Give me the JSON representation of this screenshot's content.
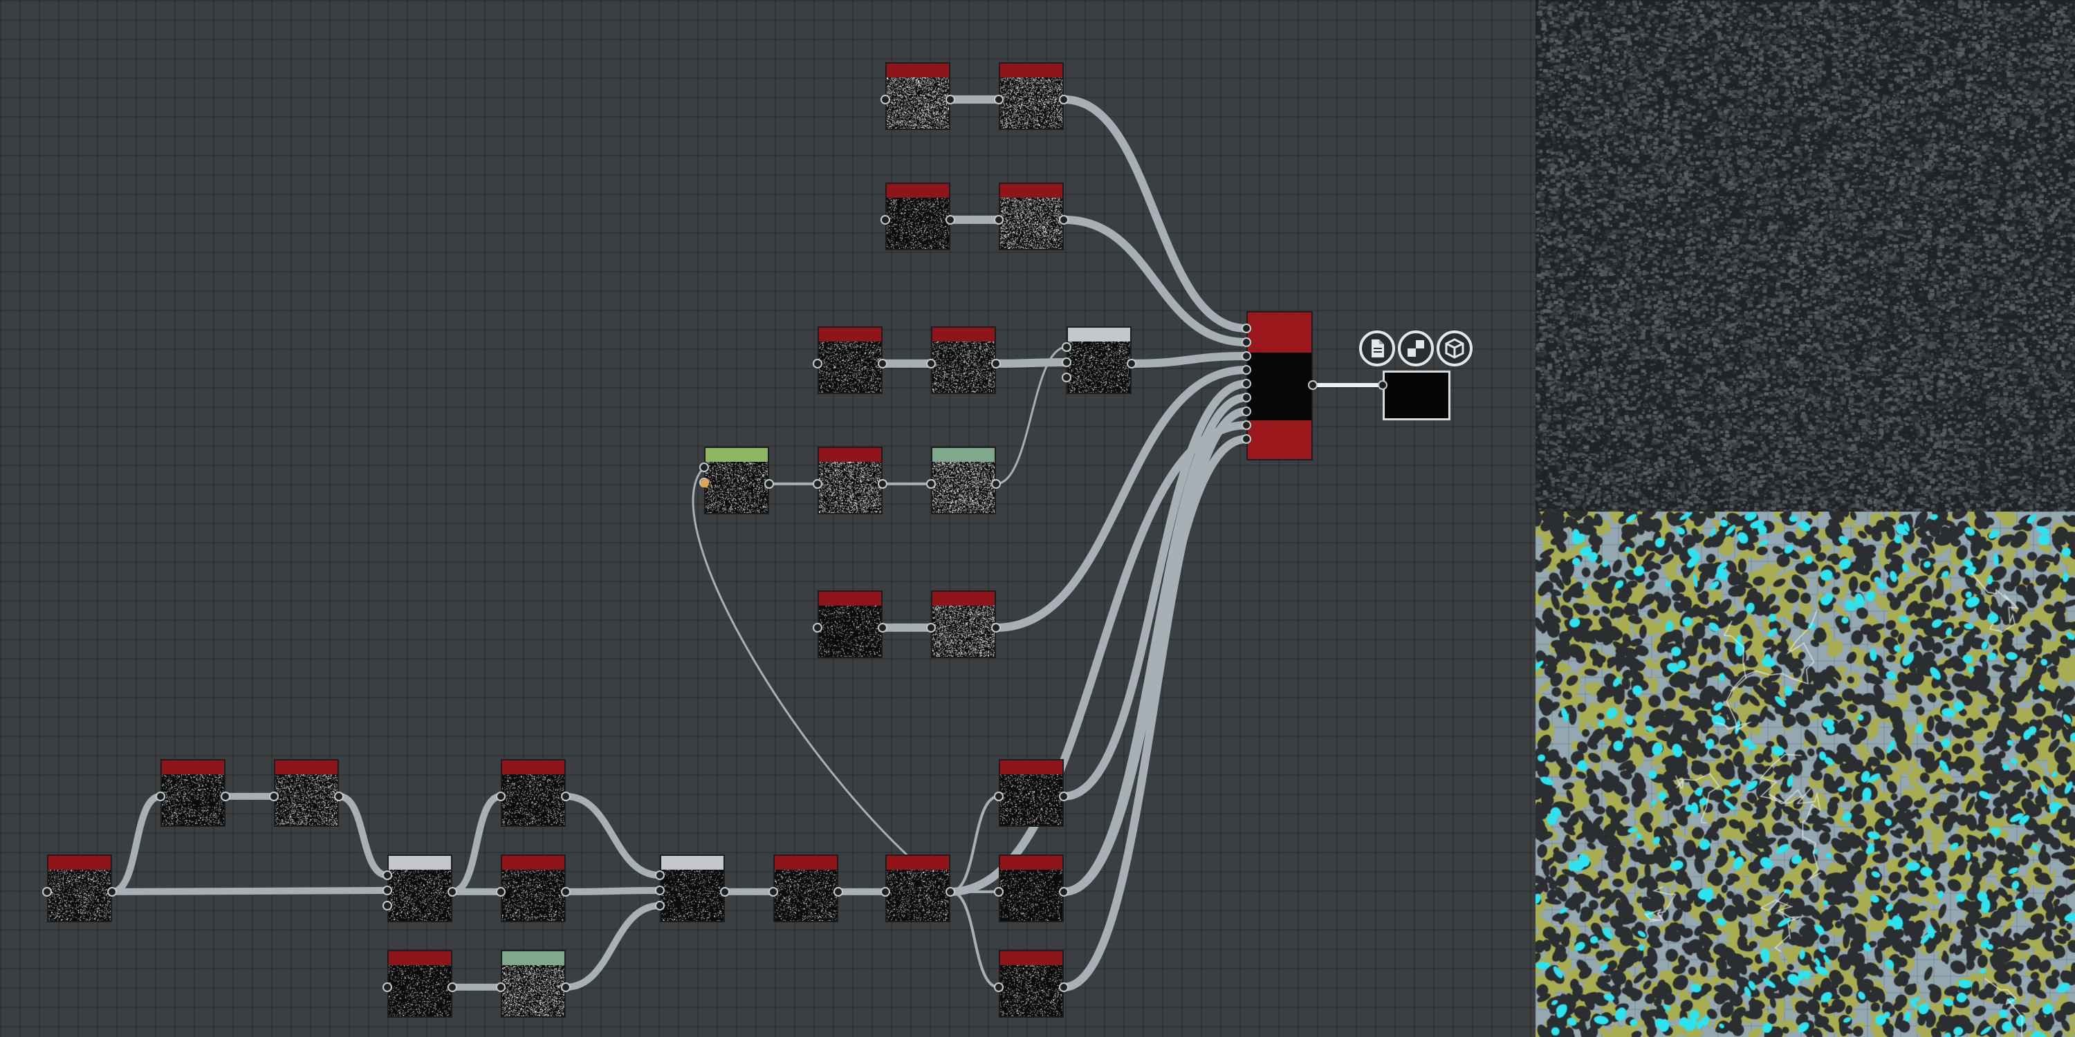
{
  "colors": {
    "canvas_bg": "#3b3f42",
    "wire": "#a7b1b5",
    "node_header_red": "#8f1518",
    "node_header_white": "#c4c8cc",
    "node_header_green": "#8fb864",
    "node_header_mint": "#7ea98a",
    "port_link": "#e2a64a",
    "preview_cyan": "#2de3f0",
    "preview_olive": "#a9ad52"
  },
  "graph": {
    "nodes": [
      {
        "id": "n-tl-a",
        "header": "red",
        "density": 0.85,
        "inputs": 1,
        "outputs": 1
      },
      {
        "id": "n-tl-b",
        "header": "red",
        "density": 0.7,
        "inputs": 1,
        "outputs": 1
      },
      {
        "id": "n-tm-a",
        "header": "red",
        "density": 0.3,
        "inputs": 1,
        "outputs": 1
      },
      {
        "id": "n-tm-b",
        "header": "red",
        "density": 0.75,
        "inputs": 1,
        "outputs": 1
      },
      {
        "id": "n-m1-a",
        "header": "red",
        "density": 0.35,
        "inputs": 1,
        "outputs": 1
      },
      {
        "id": "n-m1-b",
        "header": "red",
        "density": 0.45,
        "inputs": 1,
        "outputs": 1
      },
      {
        "id": "n-m1-blend",
        "header": "white",
        "density": 0.35,
        "inputs": 3,
        "outputs": 1
      },
      {
        "id": "n-m2-src",
        "header": "green",
        "density": 0.5,
        "inputs": 2,
        "outputs": 1
      },
      {
        "id": "n-m2-b",
        "header": "red",
        "density": 0.75,
        "inputs": 1,
        "outputs": 1
      },
      {
        "id": "n-m2-c",
        "header": "mint",
        "density": 0.85,
        "inputs": 1,
        "outputs": 1
      },
      {
        "id": "n-m3-a",
        "header": "red",
        "density": 0.25,
        "inputs": 1,
        "outputs": 1
      },
      {
        "id": "n-m3-b",
        "header": "red",
        "density": 0.8,
        "inputs": 1,
        "outputs": 1
      },
      {
        "id": "n-bl-0",
        "header": "red",
        "density": 0.4,
        "inputs": 1,
        "outputs": 1
      },
      {
        "id": "n-bl-1",
        "header": "red",
        "density": 0.35,
        "inputs": 1,
        "outputs": 1
      },
      {
        "id": "n-bl-2",
        "header": "red",
        "density": 0.5,
        "inputs": 1,
        "outputs": 1
      },
      {
        "id": "n-bl-blend1",
        "header": "white",
        "density": 0.3,
        "inputs": 3,
        "outputs": 1
      },
      {
        "id": "n-bl-3",
        "header": "red",
        "density": 0.3,
        "inputs": 1,
        "outputs": 1
      },
      {
        "id": "n-bl-4",
        "header": "red",
        "density": 0.3,
        "inputs": 1,
        "outputs": 1
      },
      {
        "id": "n-bl-5",
        "header": "red",
        "density": 0.25,
        "inputs": 1,
        "outputs": 1
      },
      {
        "id": "n-bl-6",
        "header": "mint",
        "density": 0.75,
        "inputs": 1,
        "outputs": 1
      },
      {
        "id": "n-bl-blend2",
        "header": "white",
        "density": 0.25,
        "inputs": 3,
        "outputs": 1
      },
      {
        "id": "n-bl-7",
        "header": "red",
        "density": 0.3,
        "inputs": 1,
        "outputs": 1
      },
      {
        "id": "n-bl-8",
        "header": "red",
        "density": 0.3,
        "inputs": 1,
        "outputs": 1
      },
      {
        "id": "n-br-a",
        "header": "red",
        "density": 0.3,
        "inputs": 1,
        "outputs": 1
      },
      {
        "id": "n-br-b",
        "header": "red",
        "density": 0.2,
        "inputs": 1,
        "outputs": 1
      },
      {
        "id": "n-br-c",
        "header": "red",
        "density": 0.3,
        "inputs": 1,
        "outputs": 1
      }
    ],
    "material_node": {
      "inputs": 9,
      "outputs": 1
    },
    "output_node": {
      "icons": [
        {
          "name": "document-icon",
          "glyph": "🗎"
        },
        {
          "name": "checker-icon",
          "glyph": "▚"
        },
        {
          "name": "cube-icon",
          "glyph": "⬢"
        }
      ]
    }
  }
}
